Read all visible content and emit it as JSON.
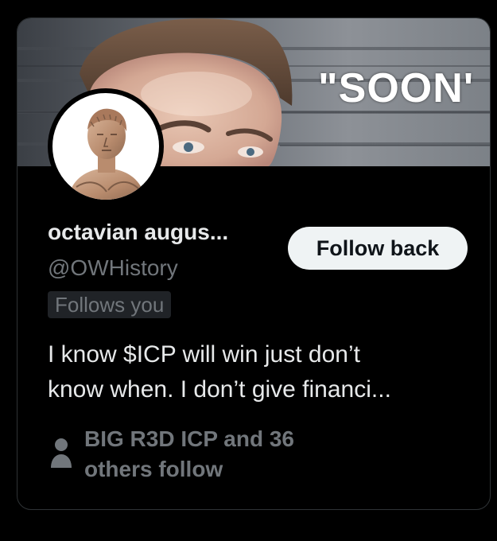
{
  "banner": {
    "text": "\"SOON'",
    "icon": "person-photo"
  },
  "avatar": {
    "icon": "roman-bust-portrait"
  },
  "profile": {
    "name": "octavian augus...",
    "handle": "@OWHistory",
    "follows_you": "Follows you",
    "bio_line1": "I know $ICP will win just don’t",
    "bio_line2": "know when. I don’t give financi..."
  },
  "follow_button": {
    "label": "Follow back"
  },
  "followers": {
    "icon": "person-icon",
    "line1": "BIG R3D ICP and 36",
    "line2": "others follow"
  },
  "colors": {
    "background": "#000000",
    "card_border": "#2f3336",
    "primary_text": "#e7e9ea",
    "secondary_text": "#71767b",
    "button_bg": "#eff3f4",
    "button_text": "#0f1419",
    "badge_bg": "#202327"
  }
}
